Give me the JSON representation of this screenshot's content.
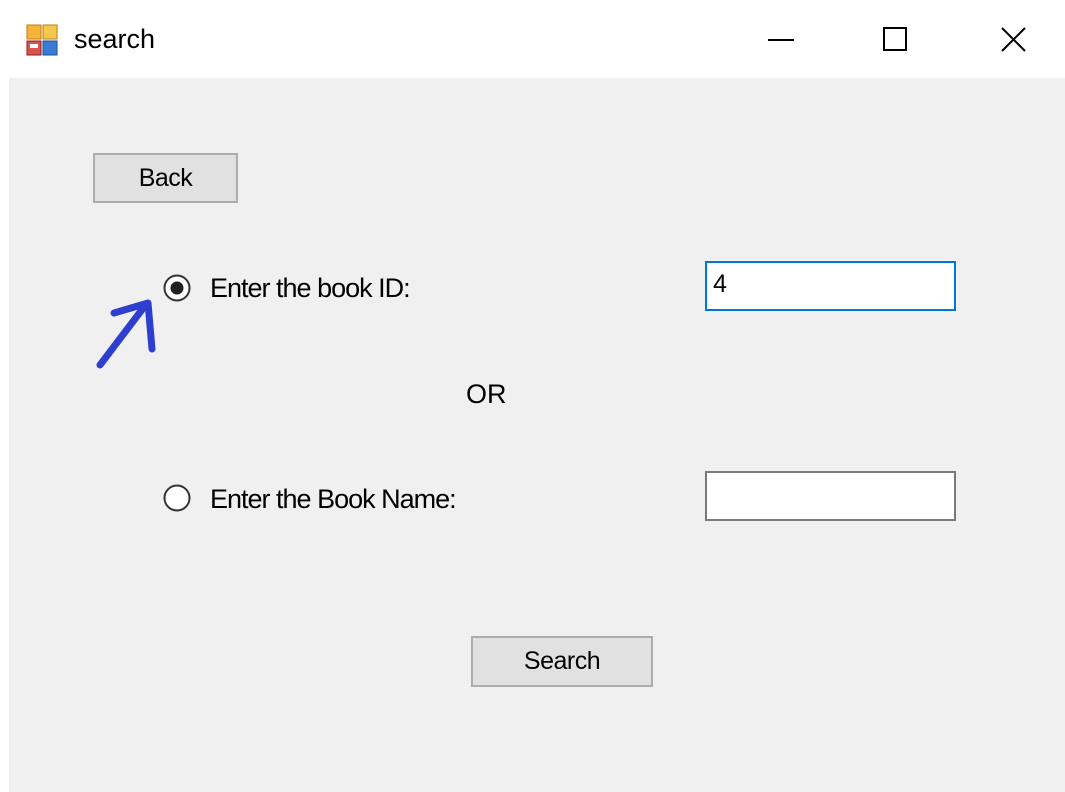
{
  "window": {
    "title": "search",
    "controls": {
      "minimize_icon": "minimize-icon",
      "maximize_icon": "maximize-icon",
      "close_icon": "close-icon"
    }
  },
  "form": {
    "back_label": "Back",
    "option_id": {
      "label": "Enter the book ID:",
      "selected": true,
      "value": "4"
    },
    "or_label": "OR",
    "option_name": {
      "label": "Enter the Book Name:",
      "selected": false,
      "value": ""
    },
    "search_label": "Search"
  },
  "annotation": {
    "icon": "hand-drawn-arrow-icon",
    "color": "#2e3fd0"
  },
  "colors": {
    "focus_border": "#0078d7",
    "client_bg": "#f0f0f0",
    "button_bg": "#e1e1e1"
  }
}
